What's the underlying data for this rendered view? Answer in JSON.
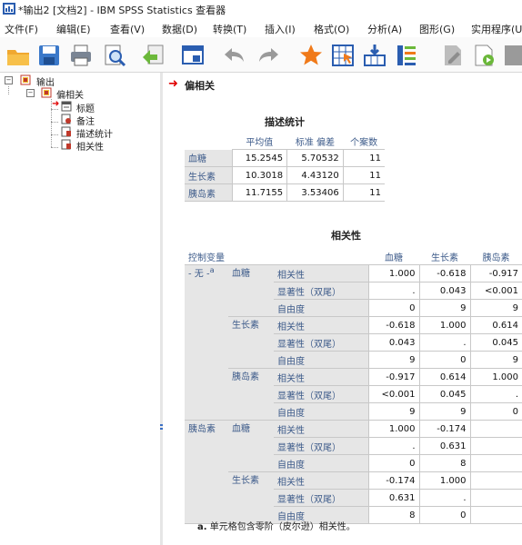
{
  "window": {
    "title": "*输出2 [文档2] - IBM SPSS Statistics 查看器"
  },
  "menu": [
    "文件(F)",
    "编辑(E)",
    "查看(V)",
    "数据(D)",
    "转换(T)",
    "插入(I)",
    "格式(O)",
    "分析(A)",
    "图形(G)",
    "实用程序(U)"
  ],
  "toolbar": {
    "icons": [
      "open-folder-icon",
      "save-icon",
      "print-icon",
      "print-preview-icon",
      "export-icon",
      "recall-dialog-icon",
      "undo-icon",
      "redo-icon",
      "goto-data-icon",
      "goto-case-icon",
      "goto-variable-icon",
      "variables-icon",
      "designate-window-icon",
      "script-icon",
      "run-icon"
    ]
  },
  "nav": {
    "output": "输出",
    "partial_corr": "偏相关",
    "title": "标题",
    "notes": "备注",
    "desc_stats": "描述统计",
    "correlations": "相关性"
  },
  "content": {
    "heading": "偏相关",
    "descriptive": {
      "title": "描述统计",
      "headers": [
        "平均值",
        "标准 偏差",
        "个案数"
      ],
      "rows": [
        {
          "name": "血糖",
          "mean": "15.2545",
          "sd": "5.70532",
          "n": "11"
        },
        {
          "name": "生长素",
          "mean": "10.3018",
          "sd": "4.43120",
          "n": "11"
        },
        {
          "name": "胰岛素",
          "mean": "11.7155",
          "sd": "3.53406",
          "n": "11"
        }
      ]
    },
    "correlation": {
      "title": "相关性",
      "control_header": "控制变量",
      "col_headers": [
        "血糖",
        "生长素",
        "胰岛素"
      ],
      "groups": [
        {
          "control": "- 无 -",
          "control_sup": "a",
          "vars": [
            {
              "name": "血糖",
              "rows": [
                {
                  "stat": "相关性",
                  "vals": [
                    "1.000",
                    "-0.618",
                    "-0.917"
                  ]
                },
                {
                  "stat": "显著性（双尾）",
                  "vals": [
                    ".",
                    "0.043",
                    "<0.001"
                  ]
                },
                {
                  "stat": "自由度",
                  "vals": [
                    "0",
                    "9",
                    "9"
                  ]
                }
              ]
            },
            {
              "name": "生长素",
              "rows": [
                {
                  "stat": "相关性",
                  "vals": [
                    "-0.618",
                    "1.000",
                    "0.614"
                  ]
                },
                {
                  "stat": "显著性（双尾）",
                  "vals": [
                    "0.043",
                    ".",
                    "0.045"
                  ]
                },
                {
                  "stat": "自由度",
                  "vals": [
                    "9",
                    "0",
                    "9"
                  ]
                }
              ]
            },
            {
              "name": "胰岛素",
              "rows": [
                {
                  "stat": "相关性",
                  "vals": [
                    "-0.917",
                    "0.614",
                    "1.000"
                  ]
                },
                {
                  "stat": "显著性（双尾）",
                  "vals": [
                    "<0.001",
                    "0.045",
                    "."
                  ]
                },
                {
                  "stat": "自由度",
                  "vals": [
                    "9",
                    "9",
                    "0"
                  ]
                }
              ]
            }
          ]
        },
        {
          "control": "胰岛素",
          "control_sup": "",
          "vars": [
            {
              "name": "血糖",
              "rows": [
                {
                  "stat": "相关性",
                  "vals": [
                    "1.000",
                    "-0.174",
                    ""
                  ]
                },
                {
                  "stat": "显著性（双尾）",
                  "vals": [
                    ".",
                    "0.631",
                    ""
                  ]
                },
                {
                  "stat": "自由度",
                  "vals": [
                    "0",
                    "8",
                    ""
                  ]
                }
              ]
            },
            {
              "name": "生长素",
              "rows": [
                {
                  "stat": "相关性",
                  "vals": [
                    "-0.174",
                    "1.000",
                    ""
                  ]
                },
                {
                  "stat": "显著性（双尾）",
                  "vals": [
                    "0.631",
                    ".",
                    ""
                  ]
                },
                {
                  "stat": "自由度",
                  "vals": [
                    "8",
                    "0",
                    ""
                  ]
                }
              ]
            }
          ]
        }
      ],
      "footnote_mark": "a.",
      "footnote": "单元格包含零阶（皮尔逊）相关性。"
    }
  }
}
